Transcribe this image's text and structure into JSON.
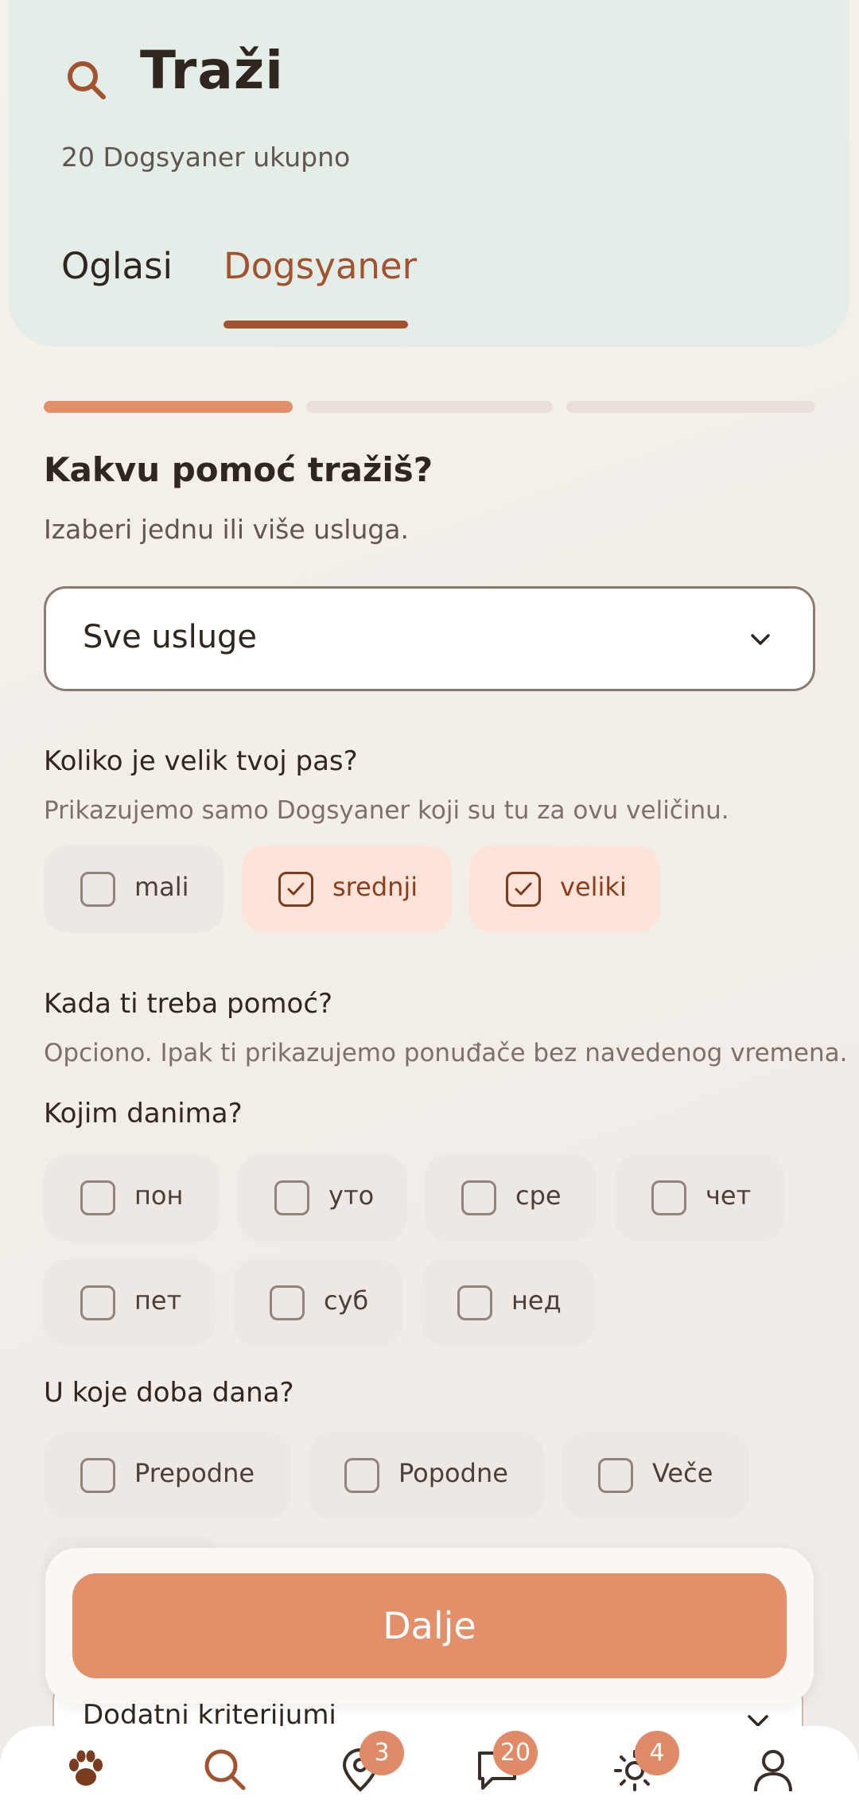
{
  "header": {
    "title": "Traži",
    "subtitle": "20 Dogsyaner ukupno",
    "tabs": [
      "Oglasi",
      "Dogsyaner"
    ],
    "active_tab": "Dogsyaner"
  },
  "progress": {
    "total_steps": 3,
    "current_step": 1
  },
  "services": {
    "question": "Kakvu pomoć tražiš?",
    "hint": "Izaberi jednu ili više usluga.",
    "selected": "Sve usluge"
  },
  "dog_size": {
    "question": "Koliko je velik tvoj pas?",
    "hint": "Prikazujemo samo Dogsyaner koji su tu za ovu veličinu.",
    "options": [
      {
        "label": "mali",
        "checked": false
      },
      {
        "label": "srednji",
        "checked": true
      },
      {
        "label": "veliki",
        "checked": true
      }
    ]
  },
  "when": {
    "question": "Kada ti treba pomoć?",
    "hint": "Opciono. Ipak ti prikazujemo ponuđače bez navedenog vremena.",
    "days_label": "Kojim danima?",
    "days": [
      "пон",
      "уто",
      "сре",
      "чет",
      "пет",
      "суб",
      "нед"
    ],
    "time_label": "U koje doba dana?",
    "times": [
      "Prepodne",
      "Popodne",
      "Veče"
    ]
  },
  "next_button": "Dalje",
  "extra_criteria": "Dodatni kriterijumi",
  "nav": {
    "items": [
      "paw-icon",
      "search-icon",
      "location-icon",
      "chat-icon",
      "sun-icon",
      "profile-icon"
    ],
    "badges": {
      "location": "3",
      "chat": "20",
      "sun": "4"
    }
  },
  "colors": {
    "accent": "#e28f6a",
    "accent_dark": "#a0532e",
    "header_bg": "#e5ede9",
    "chip_selected_bg": "#fde3d8"
  }
}
